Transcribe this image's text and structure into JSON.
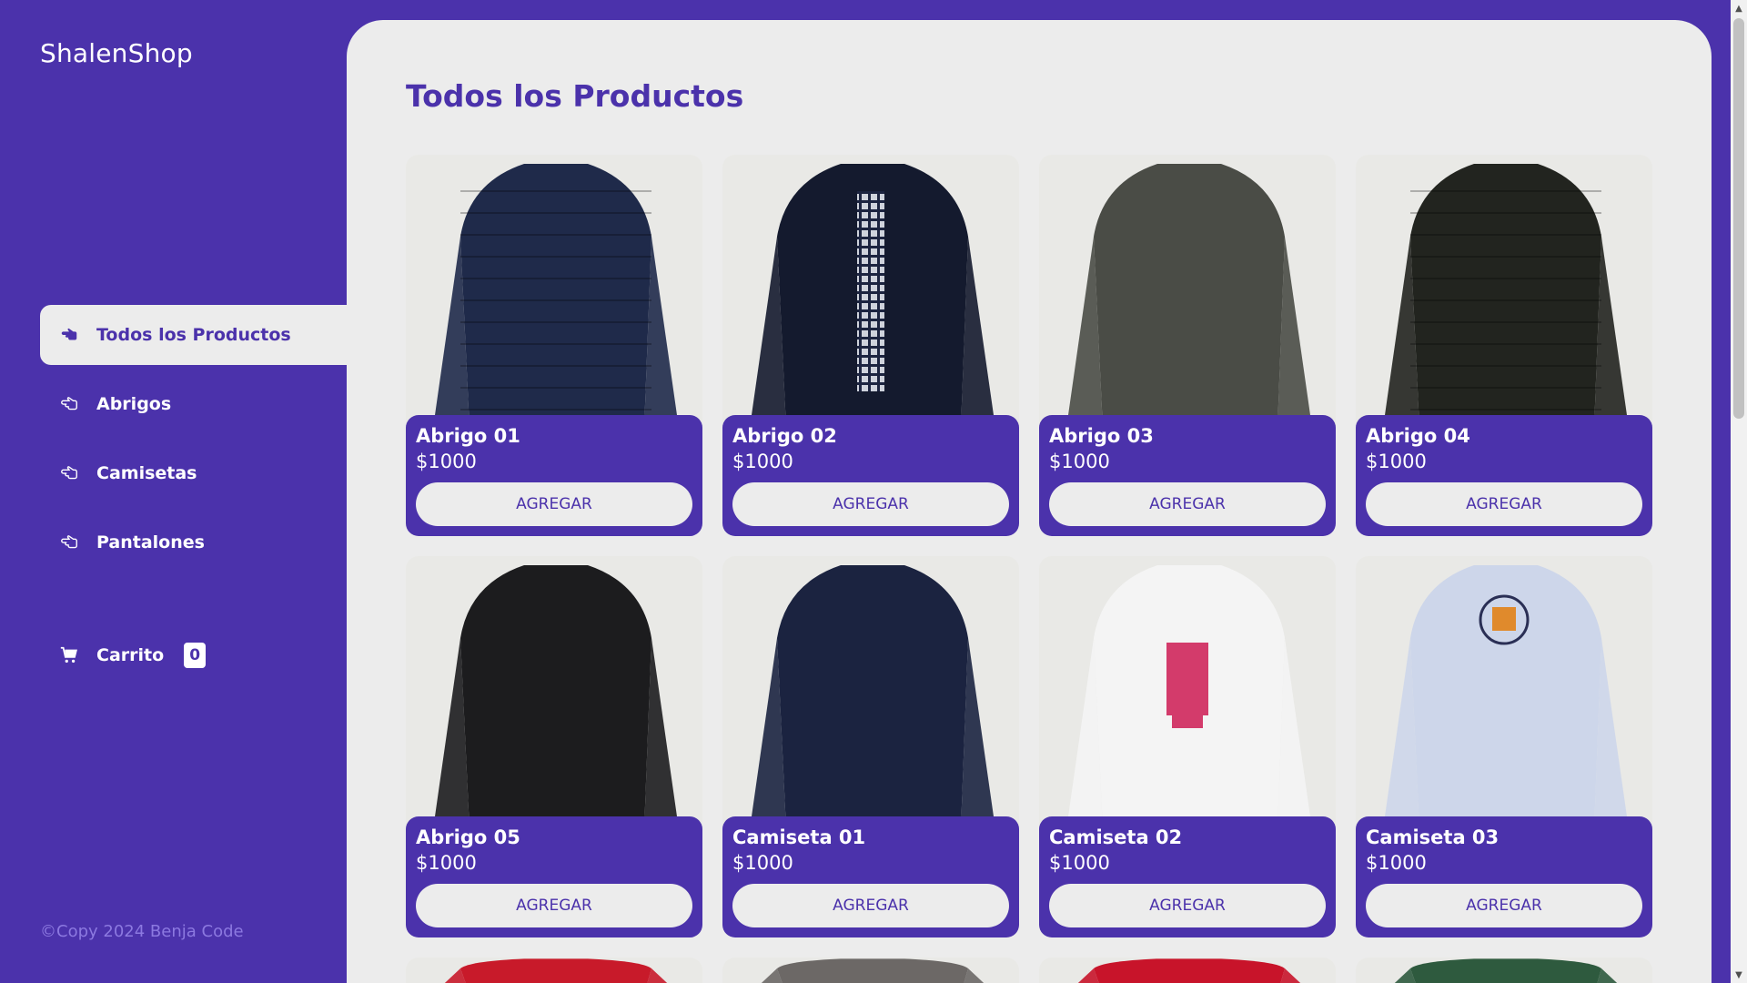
{
  "sidebar": {
    "logo": "ShalenShop",
    "menu": [
      {
        "label": "Todos los Productos",
        "active": true
      },
      {
        "label": "Abrigos",
        "active": false
      },
      {
        "label": "Camisetas",
        "active": false
      },
      {
        "label": "Pantalones",
        "active": false
      }
    ],
    "cart": {
      "label": "Carrito",
      "count": "0"
    },
    "copyright": "©Copy 2024 Benja Code"
  },
  "main": {
    "title": "Todos los Productos",
    "products": [
      {
        "name": "Abrigo 01",
        "price": "$1000",
        "button": "AGREGAR",
        "image": "navy-puffer-jacket",
        "color": "#1f2a4a"
      },
      {
        "name": "Abrigo 02",
        "price": "$1000",
        "button": "AGREGAR",
        "image": "black-jacket-plaid-shirt",
        "color": "#141a2e"
      },
      {
        "name": "Abrigo 03",
        "price": "$1000",
        "button": "AGREGAR",
        "image": "olive-grey-jacket",
        "color": "#4a4c46"
      },
      {
        "name": "Abrigo 04",
        "price": "$1000",
        "button": "AGREGAR",
        "image": "black-olive-puffer-jacket",
        "color": "#22241f"
      },
      {
        "name": "Abrigo 05",
        "price": "$1000",
        "button": "AGREGAR",
        "image": "black-hooded-jacket",
        "color": "#1c1c1e"
      },
      {
        "name": "Camiseta 01",
        "price": "$1000",
        "button": "AGREGAR",
        "image": "navy-tshirt",
        "color": "#1b2340"
      },
      {
        "name": "Camiseta 02",
        "price": "$1000",
        "button": "AGREGAR",
        "image": "white-tshirt-print",
        "color": "#f4f4f4"
      },
      {
        "name": "Camiseta 03",
        "price": "$1000",
        "button": "AGREGAR",
        "image": "light-blue-tshirt-print",
        "color": "#cdd6ea"
      }
    ],
    "partial_row": [
      {
        "image": "red-tshirt",
        "color": "#c81a2a"
      },
      {
        "image": "grey-tshirt",
        "color": "#6c6866"
      },
      {
        "image": "red-tshirt",
        "color": "#c8142a"
      },
      {
        "image": "green-tshirt",
        "color": "#2e5a3e"
      }
    ]
  },
  "colors": {
    "brand": "#4b32ab",
    "surface": "#ececec",
    "copyright": "#8c79e0"
  }
}
